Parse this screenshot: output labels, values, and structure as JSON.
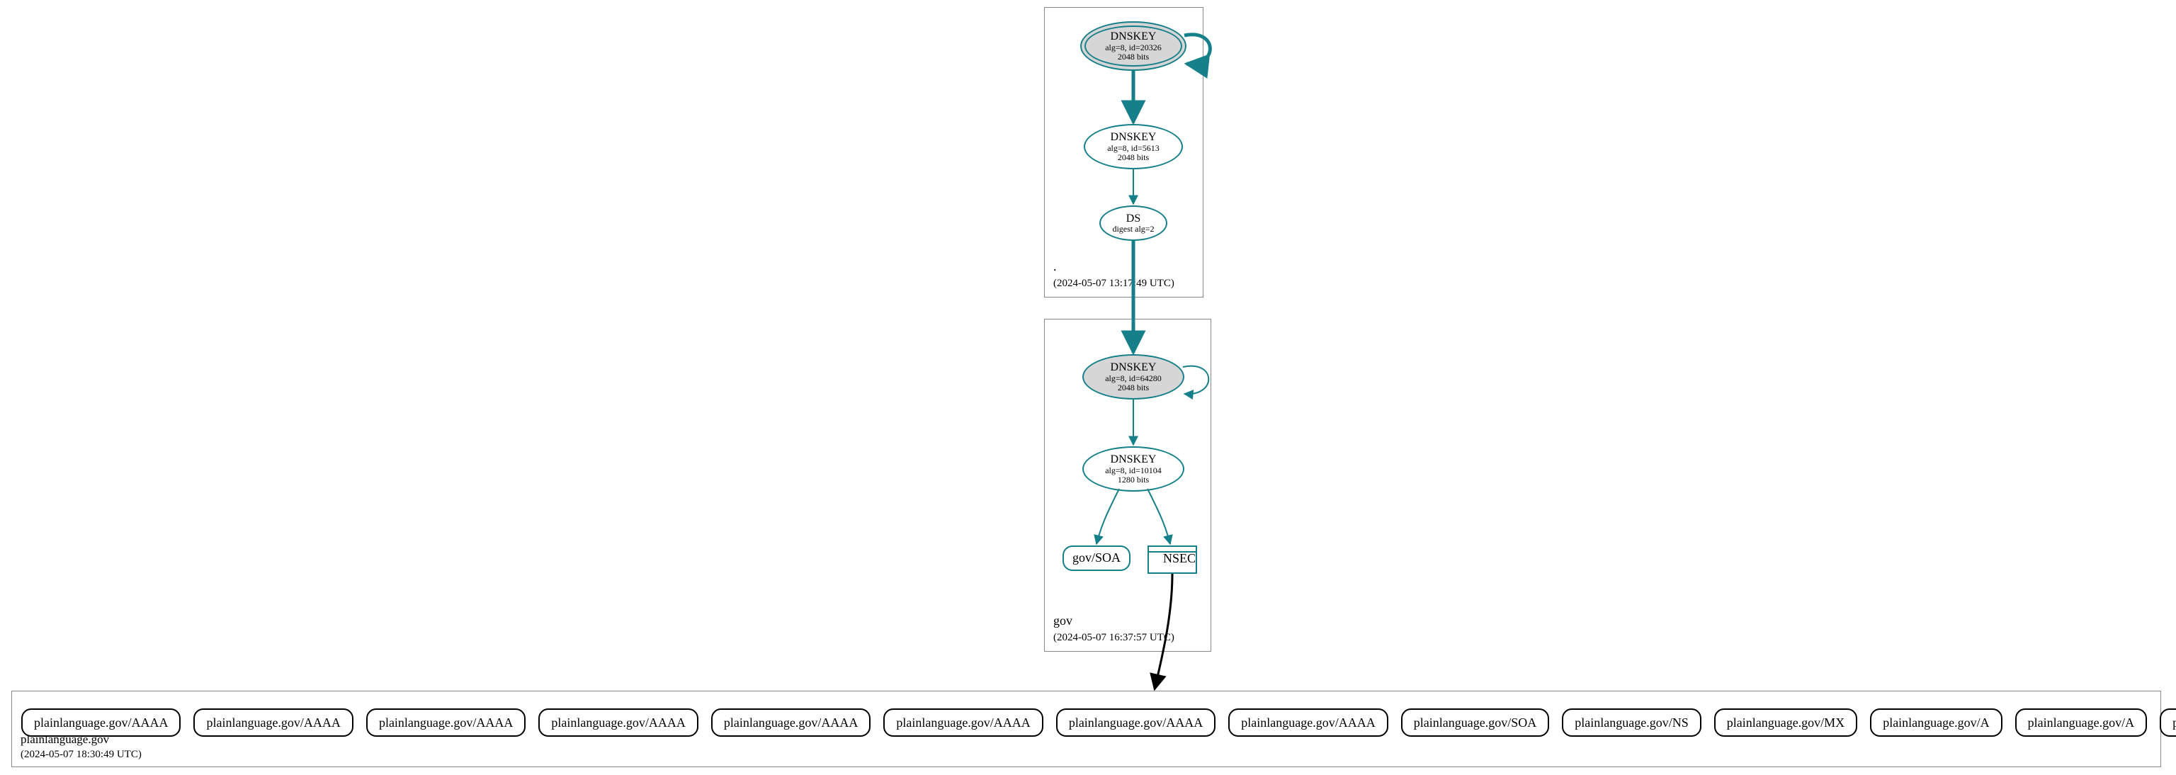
{
  "colors": {
    "teal": "#157f8a",
    "node_fill": "#d6d6d6"
  },
  "zones": {
    "root": {
      "label": ".",
      "timestamp": "(2024-05-07 13:17:49 UTC)",
      "nodes": {
        "ksk": {
          "title": "DNSKEY",
          "line1": "alg=8, id=20326",
          "line2": "2048 bits"
        },
        "zsk": {
          "title": "DNSKEY",
          "line1": "alg=8, id=5613",
          "line2": "2048 bits"
        },
        "ds": {
          "title": "DS",
          "line1": "digest alg=2"
        }
      }
    },
    "gov": {
      "label": "gov",
      "timestamp": "(2024-05-07 16:37:57 UTC)",
      "nodes": {
        "ksk": {
          "title": "DNSKEY",
          "line1": "alg=8, id=64280",
          "line2": "2048 bits"
        },
        "zsk": {
          "title": "DNSKEY",
          "line1": "alg=8, id=10104",
          "line2": "1280 bits"
        },
        "soa": {
          "label": "gov/SOA"
        },
        "nsec": {
          "label": "NSEC"
        }
      }
    },
    "leaf": {
      "label": "plainlanguage.gov",
      "timestamp": "(2024-05-07 18:30:49 UTC)",
      "records": [
        "plainlanguage.gov/AAAA",
        "plainlanguage.gov/AAAA",
        "plainlanguage.gov/AAAA",
        "plainlanguage.gov/AAAA",
        "plainlanguage.gov/AAAA",
        "plainlanguage.gov/AAAA",
        "plainlanguage.gov/AAAA",
        "plainlanguage.gov/AAAA",
        "plainlanguage.gov/SOA",
        "plainlanguage.gov/NS",
        "plainlanguage.gov/MX",
        "plainlanguage.gov/A",
        "plainlanguage.gov/A",
        "plainlanguage.gov/TXT"
      ]
    }
  }
}
